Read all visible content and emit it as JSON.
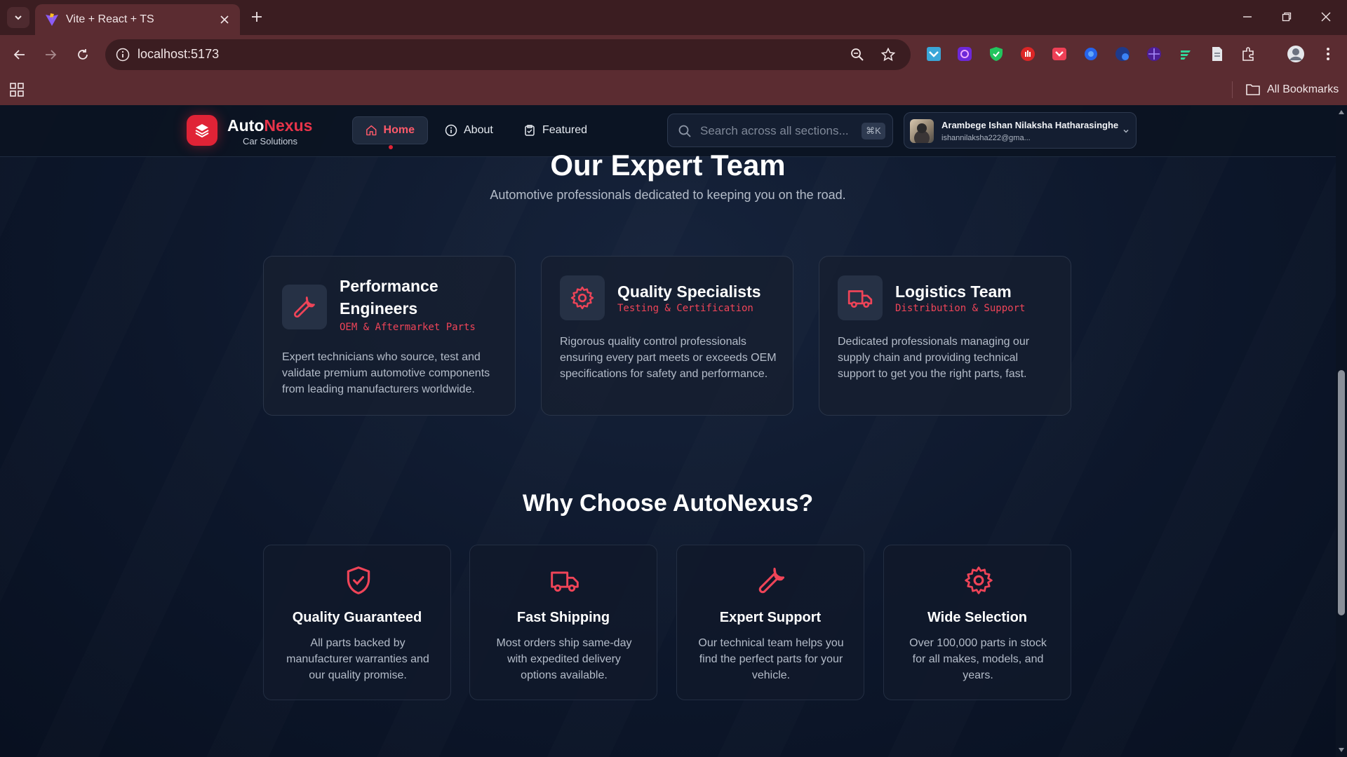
{
  "browser": {
    "tab_title": "Vite + React + TS",
    "url": "localhost:5173",
    "all_bookmarks_label": "All Bookmarks"
  },
  "site": {
    "logo_main": "Auto",
    "logo_accent": "Nexus",
    "logo_subtitle": "Car Solutions",
    "nav": [
      {
        "label": "Home",
        "icon": "home-icon",
        "active": true
      },
      {
        "label": "About",
        "icon": "info-icon"
      },
      {
        "label": "Featured",
        "icon": "clipboard-icon"
      }
    ],
    "search_placeholder": "Search across all sections...",
    "search_shortcut": "⌘K",
    "user": {
      "name": "Arambege Ishan Nilaksha Hatharasinghe",
      "email": "ishannilaksha222@gma..."
    }
  },
  "team_section": {
    "title": "Our Expert Team",
    "subtitle": "Automotive professionals dedicated to keeping you on the road.",
    "cards": [
      {
        "name": "Performance Engineers",
        "role": "OEM & Aftermarket Parts",
        "icon": "wrench-icon",
        "description": "Expert technicians who source, test and validate premium automotive components from leading manufacturers worldwide."
      },
      {
        "name": "Quality Specialists",
        "role": "Testing & Certification",
        "icon": "gear-icon",
        "description": "Rigorous quality control professionals ensuring every part meets or exceeds OEM specifications for safety and performance."
      },
      {
        "name": "Logistics Team",
        "role": "Distribution & Support",
        "icon": "truck-icon",
        "description": "Dedicated professionals managing our supply chain and providing technical support to get you the right parts, fast."
      }
    ]
  },
  "why_section": {
    "title": "Why Choose AutoNexus?",
    "cards": [
      {
        "name": "Quality Guaranteed",
        "icon": "shield-check-icon",
        "description": "All parts backed by manufacturer warranties and our quality promise."
      },
      {
        "name": "Fast Shipping",
        "icon": "truck-icon",
        "description": "Most orders ship same-day with expedited delivery options available."
      },
      {
        "name": "Expert Support",
        "icon": "wrench-icon",
        "description": "Our technical team helps you find the perfect parts for your vehicle."
      },
      {
        "name": "Wide Selection",
        "icon": "gear-icon",
        "description": "Over 100,000 parts in stock for all makes, models, and years."
      }
    ]
  },
  "colors": {
    "accent": "#e02336",
    "accent_text": "#ef4458",
    "page_bg": "#0d172b",
    "browser_frame": "#5b2c31"
  }
}
